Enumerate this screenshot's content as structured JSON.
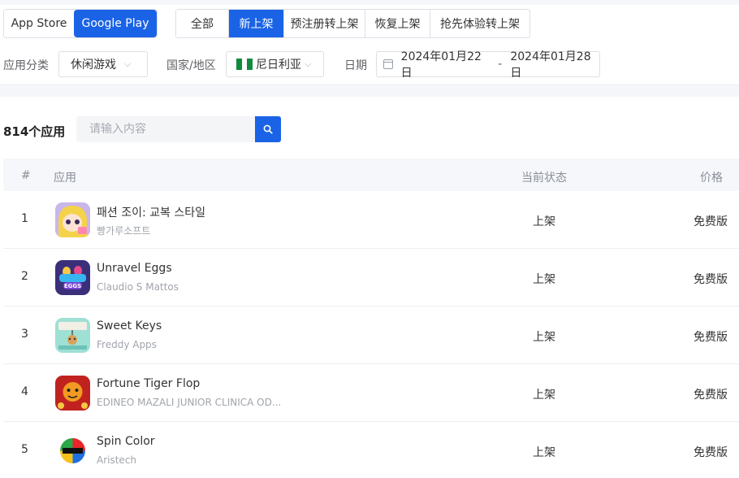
{
  "store_toggle": {
    "app_store": "App Store",
    "google_play": "Google Play",
    "active": "google_play"
  },
  "tabs": [
    {
      "label": "全部",
      "active": false
    },
    {
      "label": "新上架",
      "active": true
    },
    {
      "label": "预注册转上架",
      "active": false
    },
    {
      "label": "恢复上架",
      "active": false
    },
    {
      "label": "抢先体验转上架",
      "active": false
    }
  ],
  "filters": {
    "category_label": "应用分类",
    "category_value": "休闲游戏",
    "country_label": "国家/地区",
    "country_value": "尼日利亚",
    "date_label": "日期",
    "date_start": "2024年01月22日",
    "date_separator": "-",
    "date_end": "2024年01月28日"
  },
  "results": {
    "count_text": "814个应用"
  },
  "search": {
    "placeholder": "请输入内容"
  },
  "table": {
    "headers": {
      "rank": "#",
      "app": "应用",
      "status": "当前状态",
      "price": "价格"
    },
    "rows": [
      {
        "rank": "1",
        "name": "패션 조이: 교복 스타일",
        "developer": "빵가루소프트",
        "status": "上架",
        "price": "免费版"
      },
      {
        "rank": "2",
        "name": "Unravel Eggs",
        "developer": "Claudio S Mattos",
        "status": "上架",
        "price": "免费版"
      },
      {
        "rank": "3",
        "name": "Sweet Keys",
        "developer": "Freddy Apps",
        "status": "上架",
        "price": "免费版"
      },
      {
        "rank": "4",
        "name": "Fortune Tiger Flop",
        "developer": "EDINEO MAZALI JUNIOR CLINICA OD...",
        "status": "上架",
        "price": "免费版"
      },
      {
        "rank": "5",
        "name": "Spin Color",
        "developer": "Aristech",
        "status": "上架",
        "price": "免费版"
      }
    ]
  },
  "icons": {
    "chevron": "chevron-down-icon",
    "calendar": "calendar-icon",
    "search": "search-icon",
    "flag": "nigeria-flag-icon"
  },
  "colors": {
    "accent": "#1a63e6",
    "flag_green": "#118a3e"
  }
}
